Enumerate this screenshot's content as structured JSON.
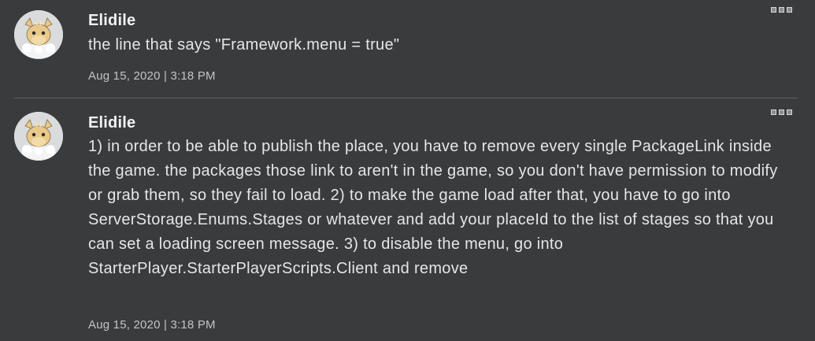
{
  "posts": [
    {
      "author": "Elidile",
      "avatar_icon": "dragon-avatar-icon",
      "body": "the line that says \"Framework.menu = true\"",
      "timestamp": "Aug 15, 2020 | 3:18 PM",
      "more_icon": "more-options-icon"
    },
    {
      "author": "Elidile",
      "avatar_icon": "dragon-avatar-icon",
      "body": "1) in order to be able to publish the place, you have to remove every single PackageLink inside the game. the packages those link to aren't in the game, so you don't have permission to modify or grab them, so they fail to load. 2) to make the game load after that, you have to go into ServerStorage.Enums.Stages or whatever and add your placeId to the list of stages so that you can set a loading screen message. 3) to disable the menu, go into StarterPlayer.StarterPlayerScripts.Client and remove",
      "timestamp": "Aug 15, 2020 | 3:18 PM",
      "more_icon": "more-options-icon"
    }
  ],
  "colors": {
    "background": "#393b3d",
    "divider": "#5f6163",
    "author_text": "#f2f2f2",
    "body_text": "#e6e6e6",
    "timestamp_text": "#c4c4c4",
    "avatar_bg": "#d9dbdc",
    "dragon": "#e8c98a"
  }
}
